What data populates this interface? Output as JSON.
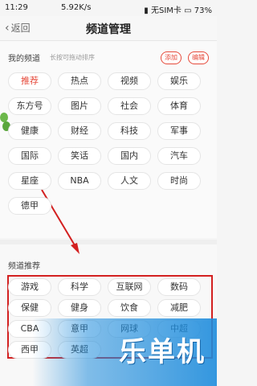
{
  "status_bar": {
    "time": "11:29",
    "speed": "5.92K/s",
    "carrier": "无SIM卡",
    "battery": "73%"
  },
  "header": {
    "back_label": "返回",
    "title": "频道管理"
  },
  "my_channels": {
    "title": "我的频道",
    "hint": "长按可拖动排序",
    "add_label": "添加",
    "edit_label": "编辑",
    "items": [
      "推荐",
      "热点",
      "视频",
      "娱乐",
      "东方号",
      "图片",
      "社会",
      "体育",
      "健康",
      "财经",
      "科技",
      "军事",
      "国际",
      "笑话",
      "国内",
      "汽车",
      "星座",
      "NBA",
      "人文",
      "时尚",
      "德甲"
    ]
  },
  "recommended": {
    "title": "频道推荐",
    "items": [
      "游戏",
      "科学",
      "互联网",
      "数码",
      "保健",
      "健身",
      "饮食",
      "减肥",
      "CBA",
      "意甲",
      "网球",
      "中超",
      "西甲",
      "英超"
    ]
  },
  "watermark": {
    "text": "乐单机"
  },
  "colors": {
    "accent": "#e64a3b",
    "annotation": "#d32020"
  }
}
